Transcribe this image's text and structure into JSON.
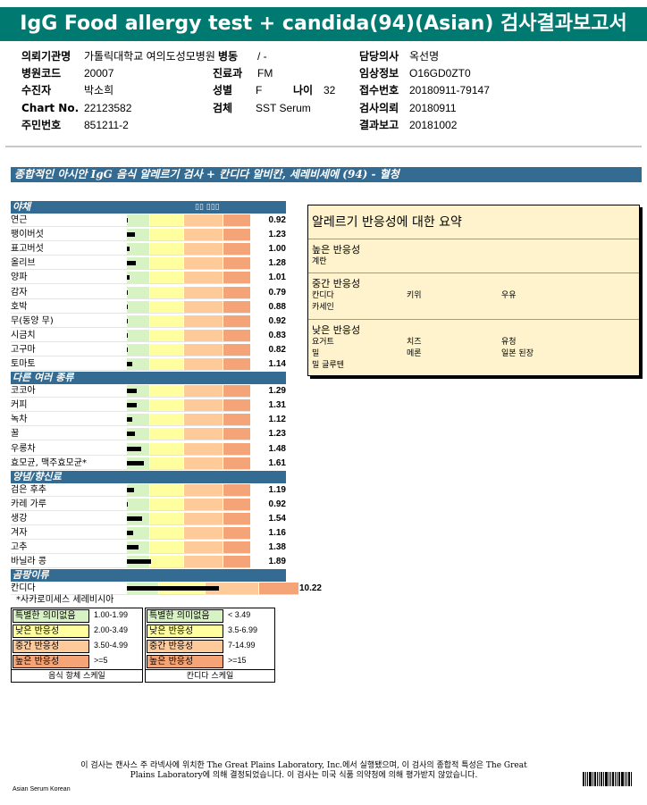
{
  "title": "IgG Food allergy test + candida(94)(Asian) 검사결과보고서",
  "info": {
    "institution_label": "의뢰기관명",
    "institution": "가톨릭대학교 여의도성모병원",
    "ward_label": "병동",
    "ward": "/ -",
    "doctor_label": "담당의사",
    "doctor": "옥선명",
    "hospital_code_label": "병원코드",
    "hospital_code": "20007",
    "dept_label": "진료과",
    "dept": "FM",
    "clinical_label": "임상정보",
    "clinical": "O16GD0ZT0",
    "receiver_label": "수진자",
    "receiver": "박소희",
    "sex_label": "성별",
    "sex": "F",
    "age_label": "나이",
    "age": "32",
    "receipt_label": "접수번호",
    "receipt": "20180911-79147",
    "chart_label": "Chart No.",
    "chart": "22123582",
    "specimen_label": "검체",
    "specimen": "SST Serum",
    "request_label": "검사의뢰",
    "request": "20180911",
    "id_label": "주민번호",
    "id": "851211-2",
    "report_label": "결과보고",
    "report": "20181002"
  },
  "banner": "종합적인 아시안 IgG 음식 알레르기 검사 + 칸디다 알비칸, 세레비세에 (94) - 혈청",
  "scale_header": "▯▯ ▯▯▯",
  "sections": [
    {
      "name": "야채",
      "items": [
        {
          "name": "연근",
          "value": "0.92",
          "level": 0.92
        },
        {
          "name": "팽이버섯",
          "value": "1.23",
          "level": 1.23
        },
        {
          "name": "표고버섯",
          "value": "1.00",
          "level": 1.0
        },
        {
          "name": "올리브",
          "value": "1.28",
          "level": 1.28
        },
        {
          "name": "양파",
          "value": "1.01",
          "level": 1.01
        },
        {
          "name": "감자",
          "value": "0.79",
          "level": 0.79
        },
        {
          "name": "호박",
          "value": "0.88",
          "level": 0.88
        },
        {
          "name": "무(동양 무)",
          "value": "0.92",
          "level": 0.92
        },
        {
          "name": "시금치",
          "value": "0.83",
          "level": 0.83
        },
        {
          "name": "고구마",
          "value": "0.82",
          "level": 0.82
        },
        {
          "name": "토마토",
          "value": "1.14",
          "level": 1.14
        }
      ]
    },
    {
      "name": "다른 여러 종류",
      "items": [
        {
          "name": "코코아",
          "value": "1.29",
          "level": 1.29
        },
        {
          "name": "커피",
          "value": "1.31",
          "level": 1.31
        },
        {
          "name": "녹차",
          "value": "1.12",
          "level": 1.12
        },
        {
          "name": "꿀",
          "value": "1.23",
          "level": 1.23
        },
        {
          "name": "우롱차",
          "value": "1.48",
          "level": 1.48
        },
        {
          "name": "효모균, 맥주효모균*",
          "value": "1.61",
          "level": 1.61
        }
      ]
    },
    {
      "name": "양념/향신료",
      "items": [
        {
          "name": "검은 후추",
          "value": "1.19",
          "level": 1.19
        },
        {
          "name": "카레 가루",
          "value": "0.92",
          "level": 0.92
        },
        {
          "name": "생강",
          "value": "1.54",
          "level": 1.54
        },
        {
          "name": "겨자",
          "value": "1.16",
          "level": 1.16
        },
        {
          "name": "고추",
          "value": "1.38",
          "level": 1.38
        },
        {
          "name": "바닐라 콩",
          "value": "1.89",
          "level": 1.89
        }
      ]
    },
    {
      "name": "곰팡이류",
      "items": [
        {
          "name": "칸디다",
          "value": "10.22",
          "level": 10.22,
          "candida": true
        }
      ]
    }
  ],
  "footnote": "*사카로미세스 세레비시아",
  "legend_food": {
    "rows": [
      {
        "name": "특별한 의미없음",
        "range": "1.00-1.99"
      },
      {
        "name": "낮은 반응성",
        "range": "2.00-3.49"
      },
      {
        "name": "중간 반응성",
        "range": "3.50-4.99"
      },
      {
        "name": "높은 반응성",
        "range": ">=5"
      }
    ],
    "caption": "음식 항체 스케일"
  },
  "legend_candida": {
    "rows": [
      {
        "name": "특별한 의미없음",
        "range": "< 3.49"
      },
      {
        "name": "낮은 반응성",
        "range": "3.5-6.99"
      },
      {
        "name": "중간 반응성",
        "range": "7-14.99"
      },
      {
        "name": "높은 반응성",
        "range": ">=15"
      }
    ],
    "caption": "칸디다 스케일"
  },
  "summary": {
    "title": "알레르기 반응성에 대한 요약",
    "groups": [
      {
        "head": "높은 반응성",
        "items": [
          "계란"
        ]
      },
      {
        "head": "중간 반응성",
        "items": [
          "칸디다",
          "키위",
          "우유",
          "카세인"
        ]
      },
      {
        "head": "낮은 반응성",
        "items": [
          "요거트",
          "치즈",
          "유청",
          "밀",
          "메론",
          "일본 된장",
          "밀 글루텐"
        ]
      }
    ]
  },
  "disclaimer_line1": "이 검사는 캔사스 주 라넥사에 위치한 The Great Plains Laboratory, Inc.에서 실행됐으며,  이 검사의 종합적 특성은 The Great",
  "disclaimer_line2": "Plains Laboratory에 의해 결정되었습니다. 이 검사는 미국 식품 의약청에 의해 평가받지 않았습니다.",
  "bottom_tag": "Asian Serum Korean",
  "colors": {
    "title_bg": "#007a70",
    "section_bg": "#336b92",
    "none": "#d8f3c3",
    "low": "#ffffa0",
    "mid": "#ffca9a",
    "high": "#f4a476",
    "summary_bg": "#fef3cd"
  }
}
